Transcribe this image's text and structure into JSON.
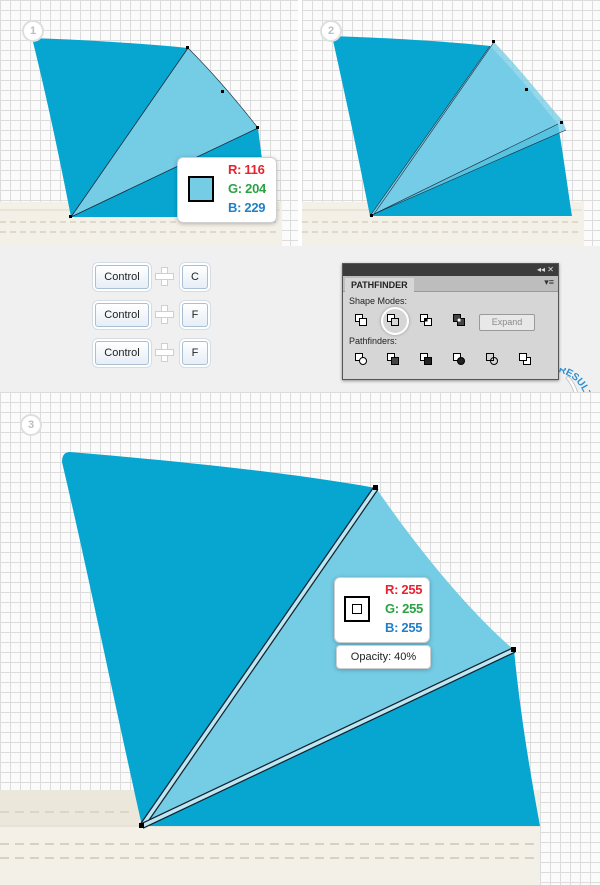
{
  "steps": [
    "1",
    "2",
    "3"
  ],
  "colors": {
    "dark_blue": "#06a6d1",
    "light_blue": "#74cce5",
    "fabric": "#f3f0e8",
    "stitch": "#d8d1c0"
  },
  "step1_color": {
    "r": "R: 116",
    "g": "G: 204",
    "b": "B: 229",
    "swatch": "#74cce5"
  },
  "step3_color": {
    "r": "R: 255",
    "g": "G: 255",
    "b": "B: 255",
    "swatch": "#ffffff",
    "opacity": "Opacity: 40%"
  },
  "shortcuts": [
    {
      "modifier": "Control",
      "key": "C"
    },
    {
      "modifier": "Control",
      "key": "F"
    },
    {
      "modifier": "Control",
      "key": "F"
    }
  ],
  "pathfinder": {
    "title": "PATHFINDER",
    "shape_modes_label": "Shape Modes:",
    "pathfinders_label": "Pathfinders:",
    "expand_label": "Expand",
    "controls": "◂◂ ✕",
    "menu_icon": "▾≡"
  },
  "result_label": "RESULT"
}
